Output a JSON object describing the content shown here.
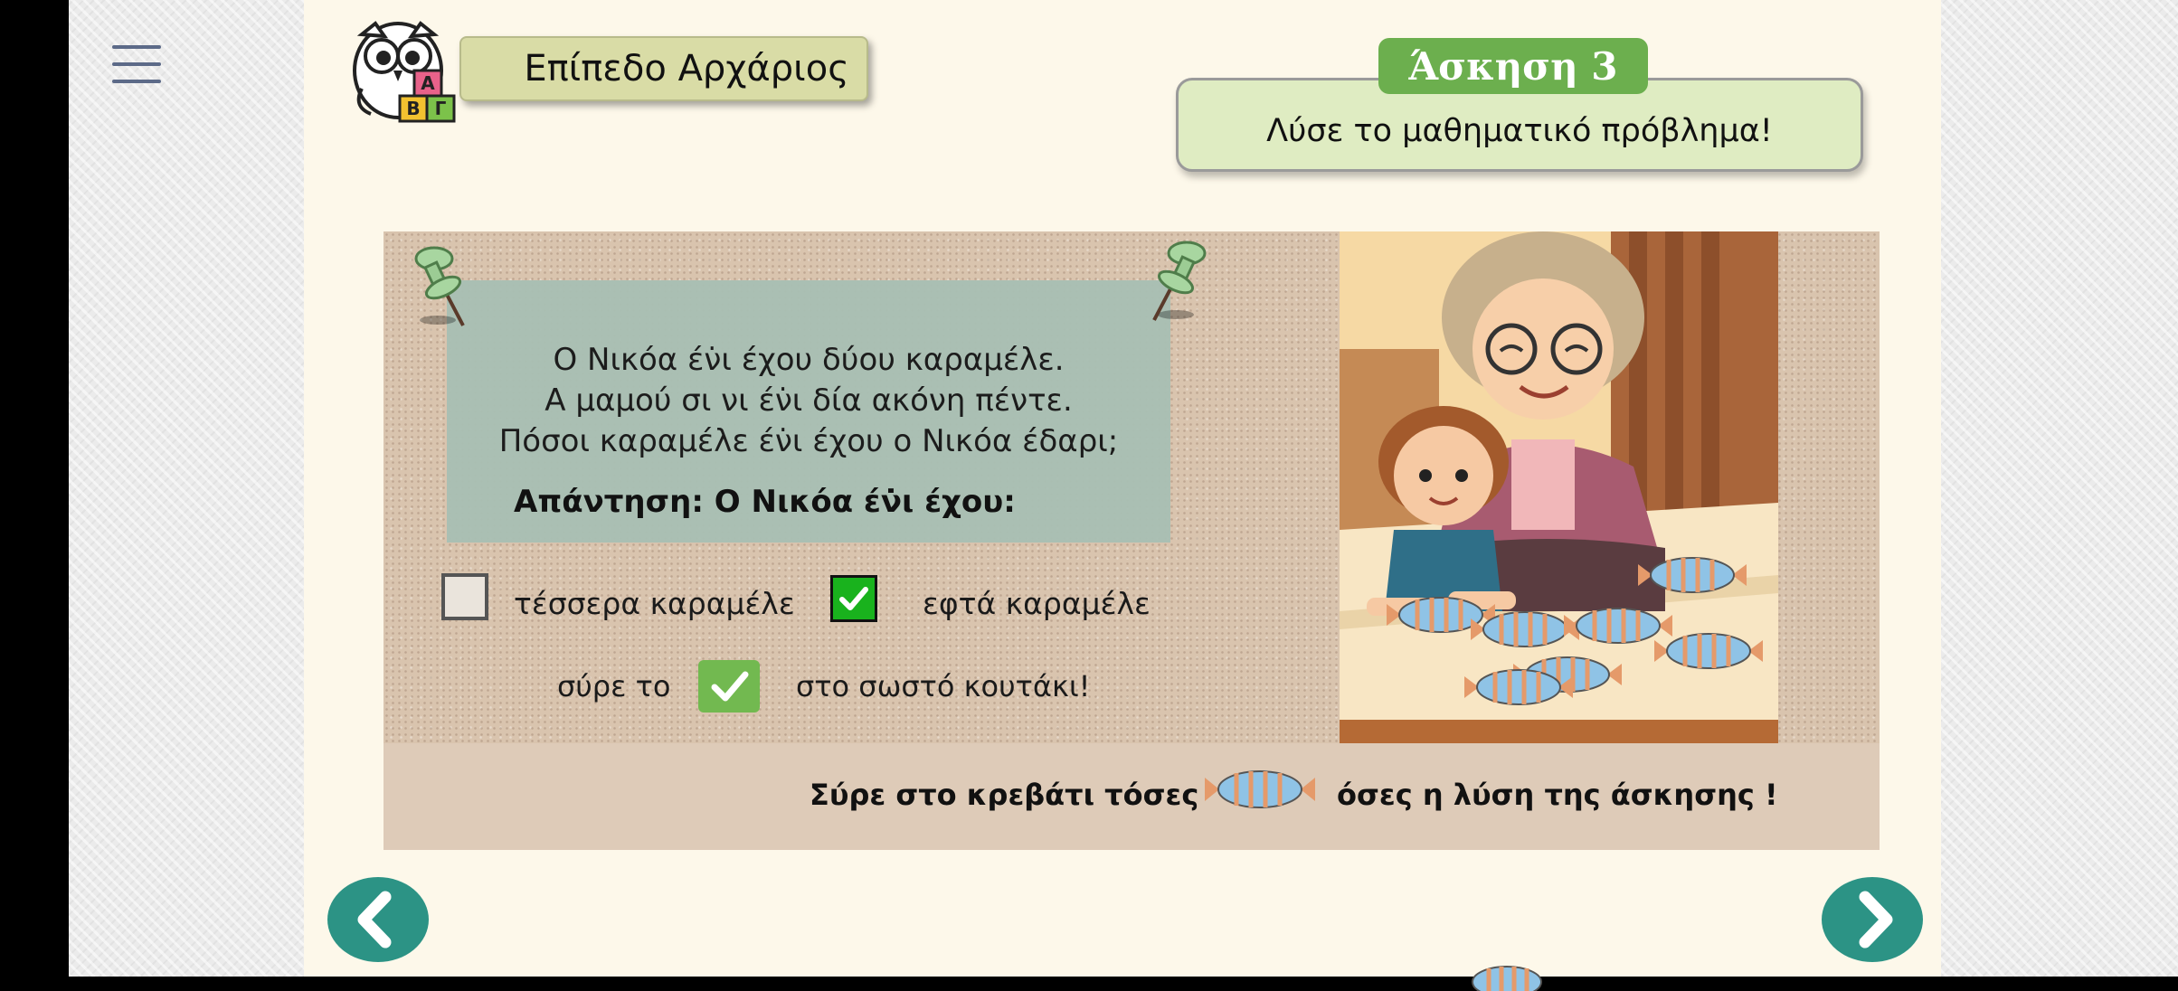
{
  "menu": {
    "icon": "hamburger-menu-icon"
  },
  "level": {
    "label": "Επίπεδο Αρχάριος",
    "icon": "owl-abc-blocks-logo"
  },
  "exercise": {
    "title": "Άσκηση 3",
    "instruction": "Λύσε το μαθηματικό πρόβλημα!"
  },
  "story": {
    "line1": "Ο Νικόα έν̇ι έχου δύου καραμέλε.",
    "line2": "Α μαμού σι νι έν̇ι δία ακόνη πέντε.",
    "line3": "Πόσοι καραμέλε έν̇ι έχου ο Νικόα έδαρι;"
  },
  "answer_label": "Απάντηση: Ο Νικόα έν̇ι έχου:",
  "options": [
    {
      "label": "τέσσερα καραμέλε",
      "checked": false
    },
    {
      "label": "εφτά καραμέλε",
      "checked": true
    }
  ],
  "drag_hint": {
    "before": "σύρε το",
    "after": "στο σωστό κουτάκι!"
  },
  "footer": {
    "before": "Σύρε στο κρεβάτι τόσες",
    "after": "όσες η λύση της άσκησης !"
  },
  "colors": {
    "accent_green": "#6caf4e",
    "instruction_bg": "#dfecc2",
    "nav_teal": "#2c9385",
    "check_green": "#19b21d",
    "candy_blue": "#8fc3e6",
    "candy_orange": "#e59a6a"
  },
  "nav": {
    "prev_icon": "chevron-left-icon",
    "next_icon": "chevron-right-icon"
  }
}
